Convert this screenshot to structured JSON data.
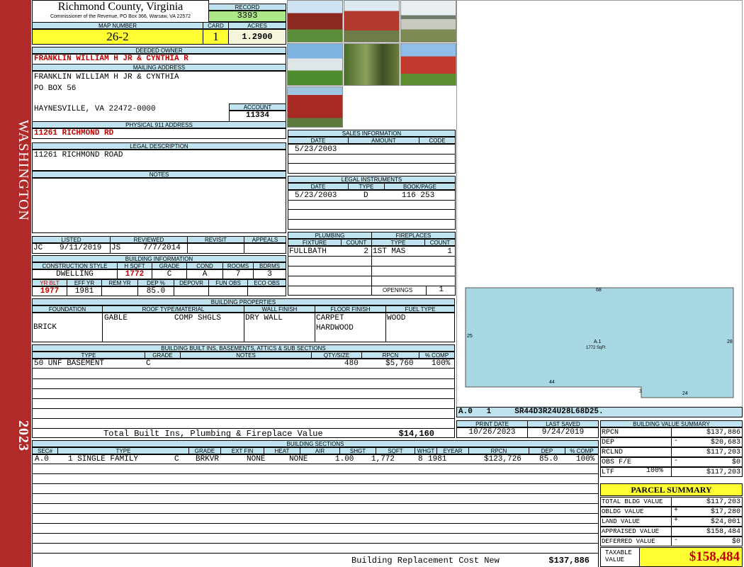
{
  "side": {
    "district": "WASHINGTON",
    "year": "2023"
  },
  "header": {
    "county": "Richmond County, Virginia",
    "commissioner": "Commissioner of the Revenue, PO Box 366, Warsaw, VA 22572",
    "record_label": "RECORD",
    "record": "3393",
    "map_label": "MAP NUMBER",
    "map": "26-2",
    "card_label": "CARD",
    "card": "1",
    "acres_label": "ACRES",
    "acres": "1.2900"
  },
  "owner": {
    "deeded_label": "DEEDED OWNER",
    "deeded": "FRANKLIN WILLIAM H JR & CYNTHIA R",
    "mailing_label": "MAILING ADDRESS",
    "mail1": "FRANKLIN WILLIAM H JR & CYNTHIA",
    "mail2": "PO BOX 56",
    "mail3": "HAYNESVILLE, VA 22472-0000",
    "account_label": "ACCOUNT",
    "account": "11334",
    "physical_label": "PHYSICAL 911 ADDRESS",
    "physical": "11261 RICHMOND RD",
    "legal_label": "LEGAL DESCRIPTION",
    "legal": "11261 RICHMOND ROAD",
    "notes_label": "NOTES"
  },
  "sales": {
    "title": "SALES INFORMATION",
    "cols": [
      "DATE",
      "AMOUNT",
      "CODE"
    ],
    "rows": [
      {
        "date": "5/23/2003",
        "amount": "",
        "code": ""
      }
    ]
  },
  "legal_instruments": {
    "title": "LEGAL INSTRUMENTS",
    "cols": [
      "DATE",
      "TYPE",
      "BOOK/PAGE"
    ],
    "rows": [
      {
        "date": "5/23/2003",
        "type": "D",
        "book": "116 253"
      }
    ]
  },
  "status": {
    "listed_label": "LISTED",
    "listed_by": "JC",
    "listed_date": "9/11/2019",
    "reviewed_label": "REVIEWED",
    "reviewed_by": "JS",
    "reviewed_date": "7/7/2014",
    "revisit_label": "REVISIT",
    "appeals_label": "APPEALS"
  },
  "building_info": {
    "title": "BUILDING INFORMATION",
    "cols1": [
      "CONSTRUCTION STYLE",
      "H SQFT",
      "GRADE",
      "COND",
      "ROOMS",
      "BDRMS"
    ],
    "vals1": [
      "DWELLING",
      "1772",
      "C",
      "A",
      "7",
      "3"
    ],
    "cols2": [
      "YR BLT",
      "EFF YR",
      "REM YR",
      "DEP %",
      "DEPOVR",
      "FUN OBS",
      "ECO OBS"
    ],
    "vals2": [
      "1977",
      "1981",
      "",
      "85.0",
      "",
      "",
      ""
    ]
  },
  "plumbing": {
    "title": "PLUMBING",
    "cols": [
      "FIXTURE",
      "COUNT"
    ],
    "rows": [
      {
        "fixture": "FULLBATH",
        "count": "2"
      }
    ]
  },
  "fireplaces": {
    "title": "FIREPLACES",
    "cols": [
      "TYPE",
      "COUNT"
    ],
    "rows": [
      {
        "type": "1ST MAS",
        "count": "1"
      }
    ],
    "openings_label": "OPENINGS",
    "openings": "1"
  },
  "properties": {
    "title": "BUILDING PROPERTIES",
    "cols": [
      "FOUNDATION",
      "ROOF TYPE/MATERIAL",
      "WALL FINISH",
      "FLOOR FINISH",
      "FUEL TYPE"
    ],
    "foundation": "BRICK",
    "roof_type": "GABLE",
    "roof_mat": "COMP SHGLS",
    "wall": "DRY WALL",
    "floor1": "CARPET",
    "floor2": "HARDWOOD",
    "fuel": "WOOD"
  },
  "builtins": {
    "title": "BUILDING BUILT INS, BASEMENTS, ATTICS & SUB SECTIONS",
    "cols": [
      "TYPE",
      "GRADE",
      "NOTES",
      "QTY/SIZE",
      "RPCN",
      "% COMP"
    ],
    "rows": [
      {
        "type": "50 UNF BASEMENT",
        "grade": "C",
        "notes": "",
        "qty": "480",
        "rpcn": "$5,760",
        "comp": "100%"
      }
    ],
    "total_label": "Total Built Ins, Plumbing & Fireplace Value",
    "total": "$14,160"
  },
  "sections": {
    "title": "BUILDING SECTIONS",
    "cols": [
      "SEC#",
      "TYPE",
      "GRADE",
      "EXT FIN",
      "HEAT",
      "AIR",
      "SHGT",
      "SQFT",
      "WHGT",
      "EYEAR",
      "RPCN",
      "DEP",
      "% COMP"
    ],
    "rows": [
      {
        "sec": "A.0",
        "type": "1 SINGLE FAMILY",
        "grade": "C",
        "ext": "BRKVR",
        "heat": "NONE",
        "air": "NONE",
        "shgt": "1.00",
        "sqft": "1,772",
        "whgt": "8",
        "eyear": "1981",
        "rpcn": "$123,726",
        "dep": "85.0",
        "comp": "100%"
      }
    ],
    "replacement_label": "Building Replacement Cost New",
    "replacement": "$137,886"
  },
  "sketch": {
    "label_top": "68",
    "label_left": "25",
    "label_right": "28",
    "label_b1": "44",
    "label_b2": "3",
    "label_b3": "24",
    "area_name": "A.1",
    "area_sqft": "1772 SqFt",
    "vector": "A.0   1     SR44D3R24U28L68D25."
  },
  "print": {
    "print_label": "PRINT DATE",
    "print_date": "10/26/2023",
    "saved_label": "LAST SAVED",
    "saved_date": "9/24/2019"
  },
  "value_summary": {
    "title": "BUILDING VALUE SUMMARY",
    "rows": [
      {
        "label": "RPCN",
        "sign": "",
        "value": "$137,886"
      },
      {
        "label": "DEP",
        "sign": "-",
        "value": "$20,683"
      },
      {
        "label": "RCLND",
        "sign": "",
        "value": "$117,203"
      },
      {
        "label": "OBS F/E",
        "sign": "-",
        "value": "$0"
      },
      {
        "label": "LTF",
        "sign": "100%",
        "value": "$117,203"
      }
    ]
  },
  "parcel": {
    "title": "PARCEL SUMMARY",
    "rows": [
      {
        "label": "TOTAL BLDG VALUE",
        "sign": "",
        "value": "$117,203"
      },
      {
        "label": "OBLDG VALUE",
        "sign": "+",
        "value": "$17,280"
      },
      {
        "label": "LAND VALUE",
        "sign": "+",
        "value": "$24,001"
      },
      {
        "label": "APPRAISED VALUE",
        "sign": "",
        "value": "$158,484"
      },
      {
        "label": "DEFERRED VALUE",
        "sign": "-",
        "value": "$0"
      }
    ],
    "taxable_label1": "TAXABLE",
    "taxable_label2": "VALUE",
    "taxable": "$158,484"
  },
  "colors": {
    "side": "#b02a2a",
    "header_fill": "#bfe3ee",
    "highlight": "#ffff33",
    "record_fill": "#aee68a",
    "sketch": "#a8d8e4",
    "red_text": "#c00000"
  }
}
